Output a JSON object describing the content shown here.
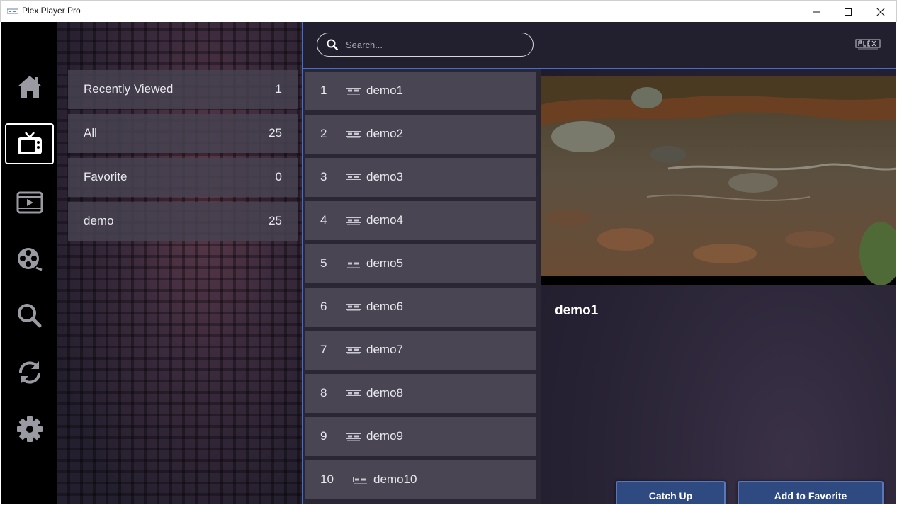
{
  "window": {
    "title": "Plex Player Pro",
    "icon": "app-logo-icon"
  },
  "nav": {
    "items": [
      {
        "name": "home",
        "icon": "home-icon"
      },
      {
        "name": "live-tv",
        "icon": "tv-icon",
        "active": true
      },
      {
        "name": "movies",
        "icon": "film-icon"
      },
      {
        "name": "series",
        "icon": "film-reel-icon"
      },
      {
        "name": "search",
        "icon": "search-icon"
      },
      {
        "name": "catch-up",
        "icon": "sync-icon"
      },
      {
        "name": "settings",
        "icon": "gear-icon"
      }
    ]
  },
  "categories": [
    {
      "label": "Recently Viewed",
      "count": "1"
    },
    {
      "label": "All",
      "count": "25"
    },
    {
      "label": "Favorite",
      "count": "0"
    },
    {
      "label": "demo",
      "count": "25"
    }
  ],
  "search": {
    "placeholder": "Search..."
  },
  "channels": [
    {
      "num": "1",
      "name": "demo1"
    },
    {
      "num": "2",
      "name": "demo2"
    },
    {
      "num": "3",
      "name": "demo3"
    },
    {
      "num": "4",
      "name": "demo4"
    },
    {
      "num": "5",
      "name": "demo5"
    },
    {
      "num": "6",
      "name": "demo6"
    },
    {
      "num": "7",
      "name": "demo7"
    },
    {
      "num": "8",
      "name": "demo8"
    },
    {
      "num": "9",
      "name": "demo9"
    },
    {
      "num": "10",
      "name": "demo10"
    }
  ],
  "preview": {
    "title": "demo1"
  },
  "actions": {
    "catch_up": "Catch Up",
    "add_favorite": "Add to Favorite"
  },
  "colors": {
    "accent": "#3f6fd1",
    "button": "#2e4a80"
  }
}
